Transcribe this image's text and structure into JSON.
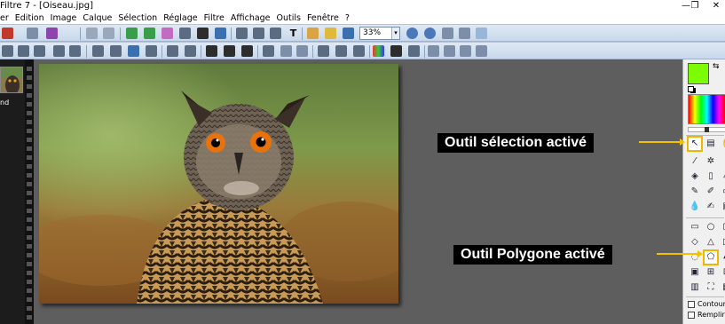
{
  "window": {
    "title": "Filtre 7 - [Oiseau.jpg]",
    "restore_glyph": "❐",
    "close_glyph": "✕"
  },
  "menu": [
    "er",
    "Edition",
    "Image",
    "Calque",
    "Sélection",
    "Réglage",
    "Filtre",
    "Affichage",
    "Outils",
    "Fenêtre",
    "?"
  ],
  "toolbar": {
    "zoom_value": "33%",
    "zoom_dropdown_glyph": "▾"
  },
  "thumbnails": {
    "label": "nd"
  },
  "image": {
    "name": "Oiseau.jpg",
    "subject": "owl photograph"
  },
  "tools": {
    "contour_label": "Contour",
    "remplir_label": "Remplir",
    "swap_glyph": "⇆"
  },
  "annotations": {
    "selection": "Outil sélection activé",
    "polygone": "Outil Polygone activé"
  },
  "colors": {
    "foreground": "#7cfc00",
    "highlight": "#f2c200",
    "workspace": "#5e5e5e"
  }
}
